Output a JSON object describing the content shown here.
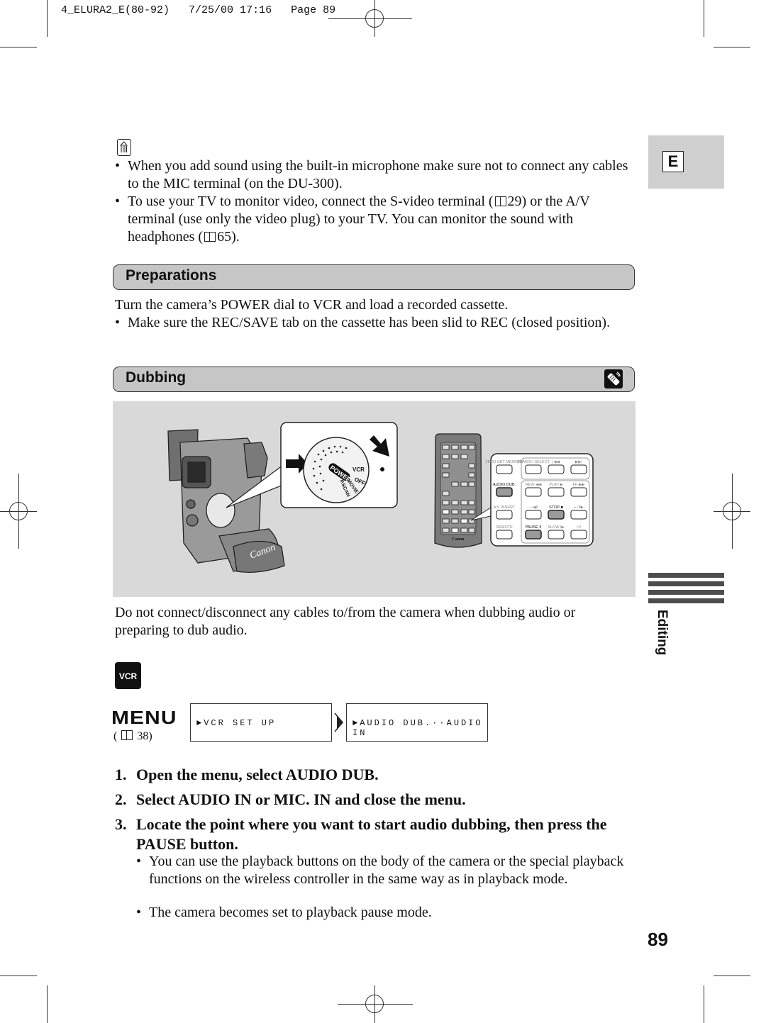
{
  "print_header": {
    "file": "4_ELURA2_E(80-92)",
    "date": "7/25/00",
    "time": "17:16",
    "page_label": "Page 89"
  },
  "side_tab": {
    "language_letter": "E",
    "section_label": "Editing"
  },
  "notes": {
    "icon": "note-memo-icon",
    "items": [
      "When you add sound using the built-in microphone make sure not to connect any cables to the MIC terminal (on the DU-300).",
      "To use your TV to monitor video, connect the S-video terminal (",
      "29) or the A/V terminal (use only the video plug) to your TV. You can monitor the sound with headphones (",
      "65)."
    ]
  },
  "preparations": {
    "heading": "Preparations",
    "intro": "Turn the camera’s POWER dial to VCR and load a recorded cassette.",
    "bullets": [
      "Make sure the REC/SAVE tab on the cassette has been slid to REC (closed position)."
    ]
  },
  "dubbing": {
    "heading": "Dubbing",
    "heading_icon": "wireless-controller-icon",
    "illustration": {
      "camera_brand": "Canon",
      "dial_labels": [
        "POWER",
        "VCR",
        "OFF",
        "MOVIE",
        "P.SCAN"
      ],
      "remote_brand": "Canon",
      "remote_buttons": [
        {
          "label": "ZERO SET MEMORY",
          "highlight": false
        },
        {
          "label": "SEARCH SELECT",
          "highlight": false
        },
        {
          "label": "|◀◀",
          "highlight": false
        },
        {
          "label": "▶▶|",
          "highlight": false
        },
        {
          "label": "AUDIO DUB.",
          "highlight": true
        },
        {
          "label": "REW ◀◀",
          "highlight": false
        },
        {
          "label": "PLAY ▶",
          "highlight": false
        },
        {
          "label": "FF ▶▶",
          "highlight": false
        },
        {
          "label": "A/V INSERT",
          "highlight": false
        },
        {
          "label": "– /◀II",
          "highlight": false
        },
        {
          "label": "STOP ■",
          "highlight": true
        },
        {
          "label": "+ /II▶",
          "highlight": false
        },
        {
          "label": "REMOTE",
          "highlight": false
        },
        {
          "label": "PAUSE II",
          "highlight": true
        },
        {
          "label": "SLOW I▶",
          "highlight": false
        },
        {
          "label": "×2",
          "highlight": false
        }
      ]
    },
    "caution": "Do not connect/disconnect any cables to/from the camera when dubbing audio or preparing to dub audio.",
    "mode_badge": "VCR",
    "menu": {
      "label": "MENU",
      "ref_page": "38",
      "path": [
        "►VCR SET UP",
        "►AUDIO DUB.··AUDIO IN"
      ]
    },
    "steps": [
      {
        "n": "1.",
        "text": "Open the menu, select AUDIO DUB."
      },
      {
        "n": "2.",
        "text": "Select AUDIO IN or MIC. IN and close the menu."
      },
      {
        "n": "3.",
        "text": "Locate the point where you want to start audio dubbing, then press the PAUSE button."
      }
    ],
    "step3_bullets": [
      "You can use the playback buttons on the body of the camera or the special playback functions on the wireless controller in the same way as in playback mode.",
      "The camera becomes set to playback pause mode."
    ]
  },
  "page_number": "89"
}
